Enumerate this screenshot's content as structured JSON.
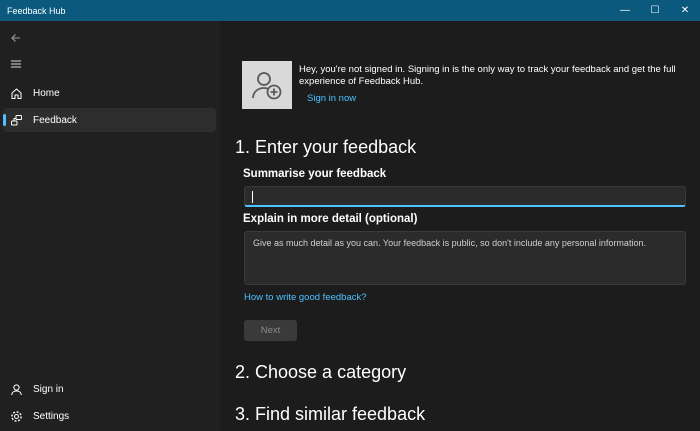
{
  "window": {
    "title": "Feedback Hub",
    "controls": {
      "minimize": "—",
      "maximize": "☐",
      "close": "✕"
    }
  },
  "sidebar": {
    "back_icon": "arrow-left-icon",
    "menu_icon": "hamburger-menu-icon",
    "items": [
      {
        "label": "Home",
        "icon": "home-icon",
        "selected": false
      },
      {
        "label": "Feedback",
        "icon": "feedback-icon",
        "selected": true
      }
    ],
    "footer": [
      {
        "label": "Sign in",
        "icon": "person-icon"
      },
      {
        "label": "Settings",
        "icon": "gear-icon"
      }
    ]
  },
  "signin_banner": {
    "text": "Hey, you're not signed in. Signing in is the only way to track your feedback and get the full experience of Feedback Hub.",
    "link": "Sign in now",
    "icon": "add-user-icon"
  },
  "steps": {
    "step1": "1. Enter your feedback",
    "step2": "2. Choose a category",
    "step3": "3. Find similar feedback"
  },
  "form": {
    "summary_label": "Summarise your feedback",
    "summary_value": "",
    "detail_label": "Explain in more detail (optional)",
    "detail_placeholder": "Give as much detail as you can. Your feedback is public, so don't include any personal information.",
    "help_link": "How to write good feedback?",
    "next_label": "Next"
  },
  "colors": {
    "accent": "#4cc2ff",
    "titlebar": "#0b5a7d",
    "background": "#1c1c1c"
  }
}
